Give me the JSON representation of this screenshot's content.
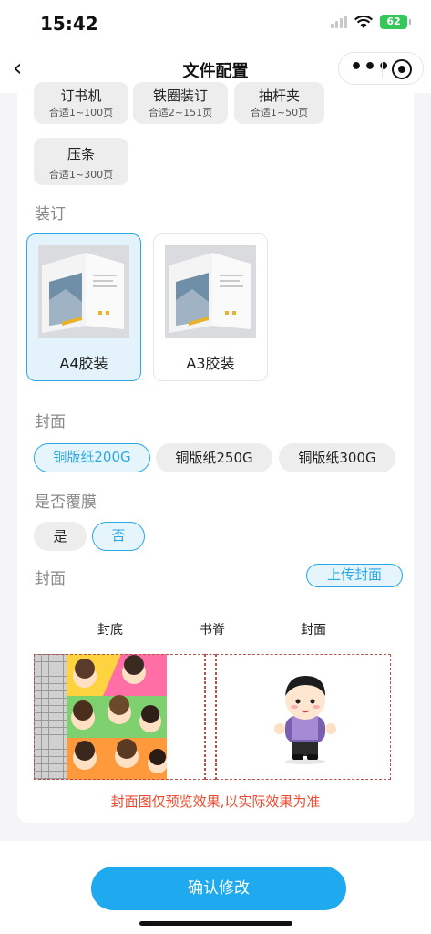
{
  "status_bar": {
    "time": "15:42",
    "battery": "62"
  },
  "nav": {
    "title": "文件配置"
  },
  "top_options": [
    {
      "title": "订书机",
      "subtitle": "合适1~100页"
    },
    {
      "title": "铁圈装订",
      "subtitle": "合适2~151页"
    },
    {
      "title": "抽杆夹",
      "subtitle": "合适1~50页"
    },
    {
      "title": "压条",
      "subtitle": "合适1~300页"
    }
  ],
  "binding": {
    "label": "装订",
    "options": [
      {
        "label": "A4胶装",
        "selected": true
      },
      {
        "label": "A3胶装",
        "selected": false
      }
    ]
  },
  "cover_paper": {
    "label": "封面",
    "options": [
      {
        "label": "铜版纸200G",
        "selected": true
      },
      {
        "label": "铜版纸250G",
        "selected": false
      },
      {
        "label": "铜版纸300G",
        "selected": false
      }
    ]
  },
  "lamination": {
    "label": "是否覆膜",
    "options": [
      {
        "label": "是",
        "selected": false
      },
      {
        "label": "否",
        "selected": true
      }
    ]
  },
  "cover_preview": {
    "label": "封面",
    "upload_label": "上传封面",
    "columns": [
      "封底",
      "书脊",
      "封面"
    ],
    "notice": "封面图仅预览效果,以实际效果为准"
  },
  "footer": {
    "confirm_label": "确认修改"
  },
  "colors": {
    "accent": "#1fa9ef",
    "notice": "#ef4a2f",
    "selected_bg": "#e4f3fb"
  }
}
